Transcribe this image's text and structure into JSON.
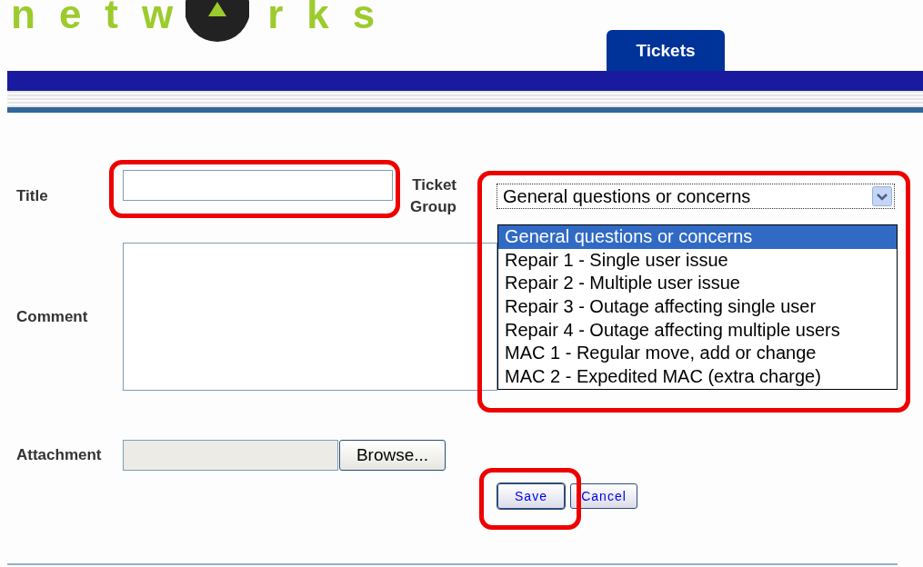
{
  "logo": {
    "left": "netw",
    "right": "rks"
  },
  "tabs": [
    {
      "label": "Tickets",
      "selected": true
    }
  ],
  "form": {
    "title": {
      "label": "Title",
      "highlighted": true
    },
    "ticket_group": {
      "label": "Ticket Group",
      "value": "General questions or concerns",
      "expanded": true,
      "highlighted": true,
      "options": [
        {
          "label": "General questions or concerns",
          "selected": true
        },
        {
          "label": "Repair 1 - Single user issue",
          "selected": false
        },
        {
          "label": "Repair 2 - Multiple user issue",
          "selected": false
        },
        {
          "label": "Repair 3 - Outage affecting single user",
          "selected": false
        },
        {
          "label": "Repair 4 - Outage affecting multiple users",
          "selected": false
        },
        {
          "label": "MAC 1 - Regular move, add or change",
          "selected": false
        },
        {
          "label": "MAC 2 - Expedited MAC (extra charge)",
          "selected": false
        }
      ]
    },
    "comment": {
      "label": "Comment"
    },
    "attachment": {
      "label": "Attachment",
      "browse": "Browse..."
    },
    "buttons": [
      {
        "label": "Save",
        "highlighted": true
      },
      {
        "label": "Cancel",
        "highlighted": false
      }
    ]
  }
}
